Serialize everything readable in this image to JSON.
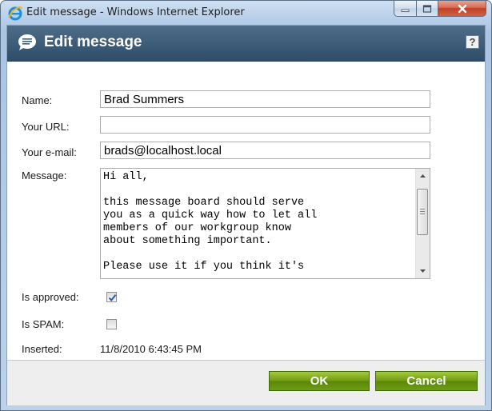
{
  "window": {
    "title": "Edit message - Windows Internet Explorer"
  },
  "header": {
    "title": "Edit message",
    "help_label": "?"
  },
  "form": {
    "name": {
      "label": "Name:",
      "value": "Brad Summers"
    },
    "url": {
      "label": "Your URL:",
      "value": ""
    },
    "email": {
      "label": "Your e-mail:",
      "value": "brads@localhost.local"
    },
    "message": {
      "label": "Message:",
      "value": "Hi all,\n\nthis message board should serve\nyou as a quick way how to let all\nmembers of our workgroup know\nabout something important.\n\nPlease use it if you think it's"
    },
    "is_approved": {
      "label": "Is approved:",
      "checked": true
    },
    "is_spam": {
      "label": "Is SPAM:",
      "checked": false
    },
    "inserted": {
      "label": "Inserted:",
      "value": "11/8/2010 6:43:45 PM"
    }
  },
  "footer": {
    "ok_label": "OK",
    "cancel_label": "Cancel"
  },
  "colors": {
    "header_bg": "#3a5976",
    "button_green": "#6f9b12",
    "checkmark": "#2a55b8"
  },
  "icons": [
    "ie-logo-icon",
    "minimize-icon",
    "maximize-icon",
    "close-icon",
    "speech-bubble-icon",
    "help-icon",
    "scroll-up-icon",
    "scroll-down-icon",
    "checkmark-icon"
  ]
}
